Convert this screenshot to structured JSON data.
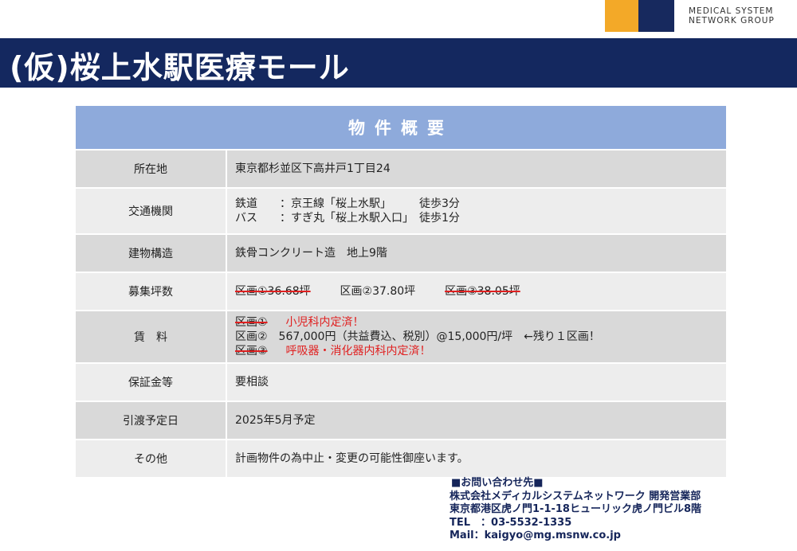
{
  "logo": {
    "brand_line1": "MEDICAL SYSTEM",
    "brand_line2": "NETWORK GROUP",
    "colors": {
      "orange": "#f3a928",
      "navy": "#17295e"
    }
  },
  "header": {
    "title": "(仮)桜上水駅医療モール",
    "access_train": "鉄道：京王線「桜上水駅」　　徒歩3分",
    "access_bus": "バス：すぎ丸「桜上水駅入口」徒歩1分"
  },
  "table": {
    "title": "物件概要",
    "rows": {
      "location": {
        "label": "所在地",
        "value": "東京都杉並区下高井戸1丁目24"
      },
      "transport": {
        "label": "交通機関",
        "line1": "鉄道　　：京王線「桜上水駅」　　　徒歩3分",
        "line2": "バス　　：すぎ丸「桜上水駅入口」　徒歩1分"
      },
      "structure": {
        "label": "建物構造",
        "value": "鉄骨コンクリート造　地上9階"
      },
      "area": {
        "label": "募集坪数",
        "unit1": "区画①36.68坪",
        "unit2": "区画②37.80坪",
        "unit3": "区画③38.05坪"
      },
      "rent": {
        "label": "賃　料",
        "unit1_name": "区画①",
        "unit1_note": "小児科内定済！",
        "unit2_text": "区画②　567,000円（共益費込、税別）@15,000円/坪　←残り１区画！",
        "unit3_name": "区画③",
        "unit3_note": "呼吸器・消化器内科内定済！"
      },
      "deposit": {
        "label": "保証金等",
        "value": "要相談"
      },
      "handover": {
        "label": "引渡予定日",
        "value": "2025年5月予定"
      },
      "other": {
        "label": "その他",
        "value": "計画物件の為中止・変更の可能性御座います。"
      }
    },
    "colors": {
      "header": "#8eaadb",
      "row_dark": "#d9d9d9",
      "row_light": "#ededed",
      "strike": "#e02020"
    }
  },
  "contact": {
    "heading": "■お問い合わせ先■",
    "company": "株式会社メディカルシステムネットワーク 開発営業部",
    "address": "東京都港区虎ノ門1-1-18ヒューリック虎ノ門ビル8階",
    "tel": "TEL　：03-5532-1335",
    "mail": "Mail：kaigyo@mg.msnw.co.jp"
  }
}
